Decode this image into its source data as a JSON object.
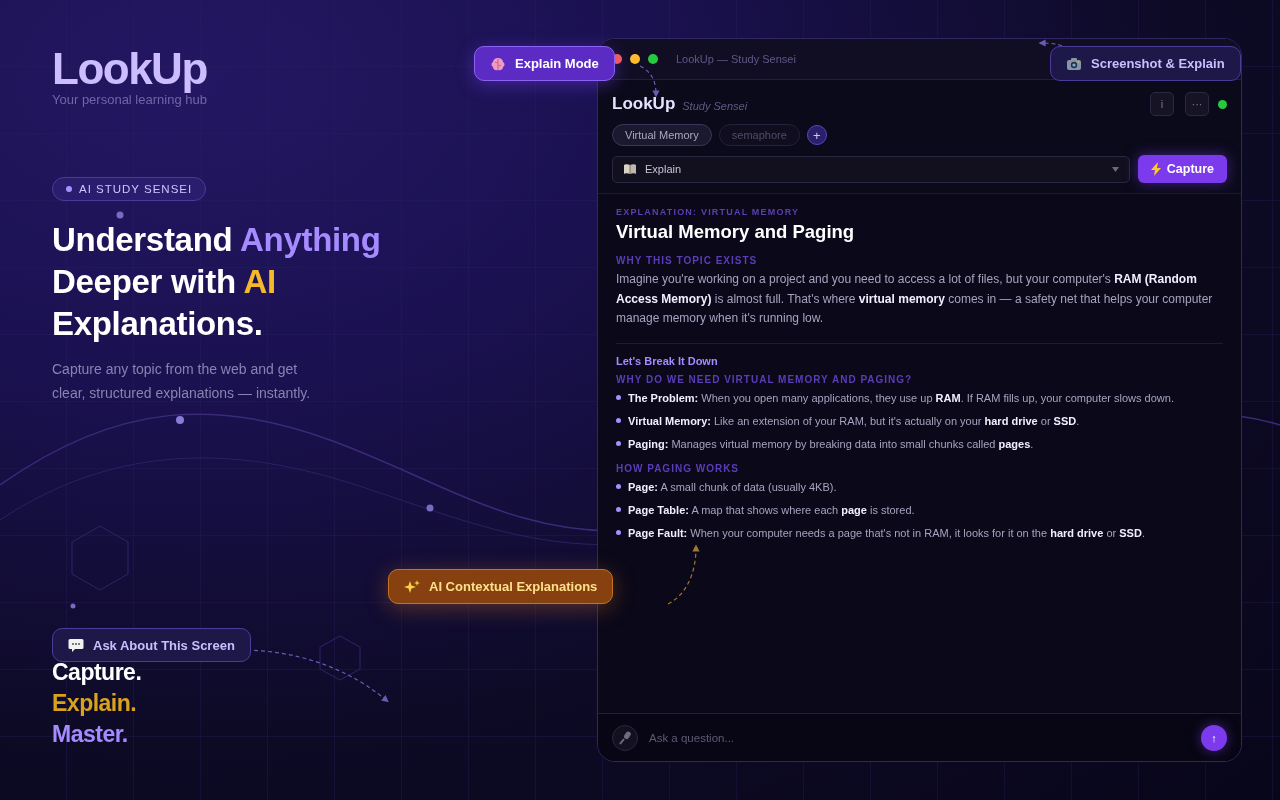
{
  "brand": {
    "name": "LookUp",
    "tagline": "Your personal learning hub"
  },
  "hero": {
    "badge": "AI STUDY SENSEI",
    "headline": [
      {
        "text": "Understand",
        "color": "#ffffff"
      },
      {
        "text": "Anything",
        "color": "#a58bff"
      },
      {
        "text": "Deeper with",
        "color": "#ffffff"
      },
      {
        "text": "AI",
        "color": "#f5b82a"
      },
      {
        "text": "Explanations.",
        "color": "#ffffff"
      }
    ],
    "description": "Capture any topic from the web and get clear, structured explanations — instantly.",
    "motto": [
      {
        "text": "Capture.",
        "color": "#ffffff"
      },
      {
        "text": "Explain.",
        "color": "#d9a21e"
      },
      {
        "text": "Master.",
        "color": "#a58bff"
      }
    ]
  },
  "floating_labels": [
    {
      "text": "Explain Mode",
      "kind": "violet"
    },
    {
      "text": "Screenshot & Explain",
      "kind": "navy"
    },
    {
      "text": "AI Contextual Explanations",
      "kind": "amber"
    },
    {
      "text": "Ask About This Screen",
      "kind": "navy"
    }
  ],
  "window": {
    "title": "LookUp — Study Sensei",
    "app_name": "LookUp",
    "subtitle": "Study Sensei",
    "header_buttons": [
      "i",
      "···"
    ],
    "online": true,
    "tabs": [
      {
        "label": "Virtual Memory",
        "selected": true
      },
      {
        "label": "semaphore",
        "selected": false
      }
    ],
    "add_tab": "+",
    "mode_select": {
      "value": "Explain"
    },
    "capture_button": "Capture",
    "content": {
      "eyebrow": "EXPLANATION: VIRTUAL MEMORY",
      "title": "Virtual Memory and Paging",
      "blocks": [
        {
          "kind": "heading",
          "text": "WHY THIS TOPIC EXISTS"
        },
        {
          "kind": "paragraph",
          "text": "Imagine you're working on a project and you need to access a lot of files, but your computer's **RAM (Random Access Memory)** is almost full. That's where **virtual memory** comes in — a safety net that helps your computer manage memory when it's running low."
        },
        {
          "kind": "subtitle",
          "text": "Let's Break It Down"
        },
        {
          "kind": "heading",
          "text": "WHY DO WE NEED VIRTUAL MEMORY AND PAGING?"
        },
        {
          "kind": "bullets",
          "items": [
            "**The Problem:** When you open many applications, they use up **RAM**. If RAM fills up, your computer slows down.",
            "**Virtual Memory:** Like an extension of your RAM, but it's actually on your **hard drive** or **SSD**.",
            "**Paging:** Manages virtual memory by breaking data into small chunks called **pages**."
          ]
        },
        {
          "kind": "heading",
          "text": "HOW PAGING WORKS"
        },
        {
          "kind": "bullets",
          "items": [
            "**Page:** A small chunk of data (usually 4KB).",
            "**Page Table:** A map that shows where each **page** is stored.",
            "**Page Fault:** When your computer needs a page that's not in RAM, it looks for it on the **hard drive** or **SSD**."
          ]
        }
      ]
    },
    "composer": {
      "placeholder": "Ask a question...",
      "send": "↑"
    }
  }
}
